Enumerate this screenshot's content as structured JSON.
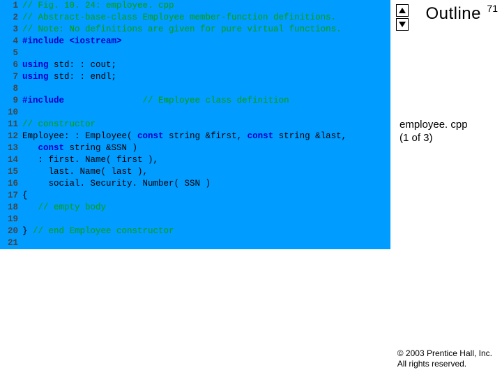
{
  "page_number": "71",
  "outline": "Outline",
  "sidebar": {
    "file": "employee. cpp",
    "part": "(1 of 3)"
  },
  "copyright": {
    "line1": "© 2003 Prentice Hall, Inc.",
    "line2": "All rights reserved."
  },
  "code": {
    "lines": [
      {
        "n": "1",
        "segs": [
          {
            "c": "cm",
            "t": "// Fig. 10. 24: employee. cpp"
          }
        ]
      },
      {
        "n": "2",
        "segs": [
          {
            "c": "cm",
            "t": "// Abstract-base-class Employee member-function definitions."
          }
        ]
      },
      {
        "n": "3",
        "segs": [
          {
            "c": "cm",
            "t": "// Note: No definitions are given for pure virtual functions."
          }
        ]
      },
      {
        "n": "4",
        "segs": [
          {
            "c": "pp",
            "t": "#include"
          },
          {
            "c": "tok",
            "t": " "
          },
          {
            "c": "pp",
            "t": "<iostream>"
          }
        ]
      },
      {
        "n": "5",
        "segs": []
      },
      {
        "n": "6",
        "segs": [
          {
            "c": "kw",
            "t": "using"
          },
          {
            "c": "tok",
            "t": " std: : cout;"
          }
        ]
      },
      {
        "n": "7",
        "segs": [
          {
            "c": "kw",
            "t": "using"
          },
          {
            "c": "tok",
            "t": " std: : endl;"
          }
        ]
      },
      {
        "n": "8",
        "segs": []
      },
      {
        "n": "9",
        "segs": [
          {
            "c": "pp",
            "t": "#include"
          },
          {
            "c": "tok",
            "t": "               "
          },
          {
            "c": "cm",
            "t": "// Employee class definition"
          }
        ]
      },
      {
        "n": "10",
        "segs": []
      },
      {
        "n": "11",
        "segs": [
          {
            "c": "cm",
            "t": "// constructor"
          }
        ]
      },
      {
        "n": "12",
        "segs": [
          {
            "c": "tok",
            "t": "Employee: : Employee( "
          },
          {
            "c": "kw",
            "t": "const"
          },
          {
            "c": "tok",
            "t": " string &first, "
          },
          {
            "c": "kw",
            "t": "const"
          },
          {
            "c": "tok",
            "t": " string &last,"
          }
        ]
      },
      {
        "n": "13",
        "segs": [
          {
            "c": "tok",
            "t": "   "
          },
          {
            "c": "kw",
            "t": "const"
          },
          {
            "c": "tok",
            "t": " string &SSN )"
          }
        ]
      },
      {
        "n": "14",
        "segs": [
          {
            "c": "tok",
            "t": "   : first. Name( first ),"
          }
        ]
      },
      {
        "n": "15",
        "segs": [
          {
            "c": "tok",
            "t": "     last. Name( last ),"
          }
        ]
      },
      {
        "n": "16",
        "segs": [
          {
            "c": "tok",
            "t": "     social. Security. Number( SSN )"
          }
        ]
      },
      {
        "n": "17",
        "segs": [
          {
            "c": "tok",
            "t": "{"
          }
        ]
      },
      {
        "n": "18",
        "segs": [
          {
            "c": "tok",
            "t": "   "
          },
          {
            "c": "cm",
            "t": "// empty body"
          }
        ]
      },
      {
        "n": "19",
        "segs": []
      },
      {
        "n": "20",
        "segs": [
          {
            "c": "tok",
            "t": "} "
          },
          {
            "c": "cm",
            "t": "// end Employee constructor"
          }
        ]
      },
      {
        "n": "21",
        "segs": []
      }
    ]
  }
}
